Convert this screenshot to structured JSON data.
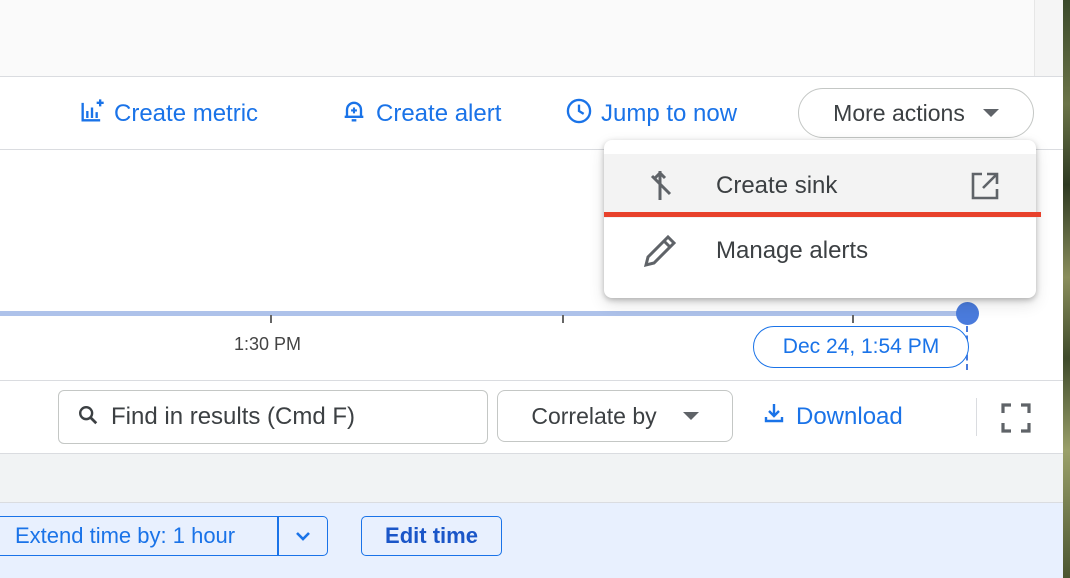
{
  "action_bar": {
    "create_metric": "Create metric",
    "create_alert": "Create alert",
    "jump_to_now": "Jump to now",
    "more_actions": "More actions"
  },
  "menu": {
    "items": [
      {
        "label": "Create sink",
        "icon": "merge-icon",
        "trailing_icon": "open-in-new-icon"
      },
      {
        "label": "Manage alerts",
        "icon": "pencil-icon"
      }
    ]
  },
  "timeline": {
    "tick_label": "1:30 PM",
    "end_time": "Dec 24, 1:54 PM"
  },
  "toolbar": {
    "search_placeholder": "Find in results (Cmd F)",
    "correlate_by": "Correlate by",
    "download": "Download"
  },
  "bottom_bar": {
    "extend_time": "Extend time by: 1 hour",
    "edit_time": "Edit time"
  },
  "colors": {
    "accent": "#1a73e8",
    "highlight_underline": "#e8412b",
    "timeline": "#aec2ea",
    "bottom_bar_bg": "#e8f0fe"
  }
}
